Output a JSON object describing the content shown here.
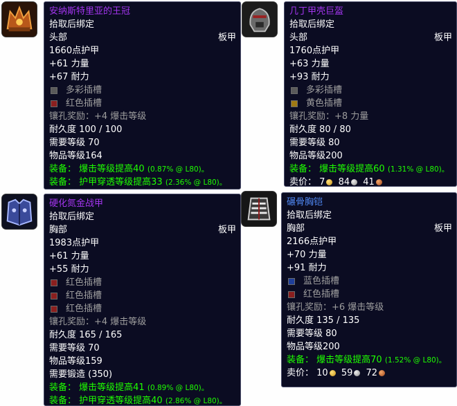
{
  "items": [
    {
      "name": "安纳斯特里亚的王冠",
      "bind": "拾取后绑定",
      "slot": "头部",
      "type": "板甲",
      "armor": "1660点护甲",
      "stats": [
        "+61 力量",
        "+67 耐力"
      ],
      "sockets": [
        {
          "label": "多彩插槽",
          "color": "#5a5a5a"
        },
        {
          "label": "红色插槽",
          "color": "#8a1f1f"
        }
      ],
      "socket_bonus": "镶孔奖励：+4 爆击等级",
      "durability": "耐久度 100 / 100",
      "req_level": "需要等级 70",
      "item_level": "物品等级164",
      "equips": [
        {
          "label": "装备：",
          "text": "爆击等级提高40",
          "note": "(0.87% @ L80)。"
        },
        {
          "label": "装备：",
          "text": "护甲穿透等级提高33",
          "note": "(2.36% @ L80)。"
        }
      ]
    },
    {
      "name": "几丁甲壳巨盔",
      "bind": "拾取后绑定",
      "slot": "头部",
      "type": "板甲",
      "armor": "1760点护甲",
      "stats": [
        "+63 力量",
        "+93 耐力"
      ],
      "sockets": [
        {
          "label": "多彩插槽",
          "color": "#5a5a5a"
        },
        {
          "label": "黄色插槽",
          "color": "#a07a14"
        }
      ],
      "socket_bonus": "镶孔奖励：+8 力量",
      "durability": "耐久度 80 / 80",
      "req_level": "需要等级 80",
      "item_level": "物品等级200",
      "equips": [
        {
          "label": "装备：",
          "text": "爆击等级提高60",
          "note": "(1.31% @ L80)。"
        }
      ],
      "sell": {
        "label": "卖价：",
        "gold": "7",
        "silver": "84",
        "copper": "41"
      }
    },
    {
      "name": "硬化氮金战甲",
      "bind": "拾取后绑定",
      "slot": "胸部",
      "type": "板甲",
      "armor": "1983点护甲",
      "stats": [
        "+61 力量",
        "+55 耐力"
      ],
      "sockets": [
        {
          "label": "红色插槽",
          "color": "#8a1f1f"
        },
        {
          "label": "红色插槽",
          "color": "#8a1f1f"
        },
        {
          "label": "红色插槽",
          "color": "#8a1f1f"
        }
      ],
      "socket_bonus": "镶孔奖励：+4 爆击等级",
      "durability": "耐久度 165 / 165",
      "req_level": "需要等级 70",
      "item_level": "物品等级159",
      "req_forge": "需要锻造 (350)",
      "equips": [
        {
          "label": "装备：",
          "text": "爆击等级提高41",
          "note": "(0.89% @ L80)。"
        },
        {
          "label": "装备：",
          "text": "护甲穿透等级提高40",
          "note": "(2.86% @ L80)。"
        }
      ]
    },
    {
      "name": "碾骨胸铠",
      "bind": "拾取后绑定",
      "slot": "胸部",
      "type": "板甲",
      "armor": "2166点护甲",
      "stats": [
        "+70 力量",
        "+91 耐力"
      ],
      "sockets": [
        {
          "label": "蓝色插槽",
          "color": "#1f3f9a"
        },
        {
          "label": "红色插槽",
          "color": "#8a1f1f"
        }
      ],
      "socket_bonus": "镶孔奖励：+6 爆击等级",
      "durability": "耐久度 135 / 135",
      "req_level": "需要等级 80",
      "item_level": "物品等级200",
      "equips": [
        {
          "label": "装备：",
          "text": "爆击等级提高70",
          "note": "(1.52% @ L80)。"
        }
      ],
      "sell": {
        "label": "卖价：",
        "gold": "10",
        "silver": "59",
        "copper": "72"
      }
    }
  ],
  "colors": {
    "epic_name": "#a335ee",
    "rare_name": "#4f86f0",
    "equip_green": "#1eff00",
    "tooltip_bg": "#0b0c22"
  },
  "icons": [
    "crown-icon",
    "helm-icon",
    "chestplate-icon",
    "bone-chest-icon"
  ]
}
